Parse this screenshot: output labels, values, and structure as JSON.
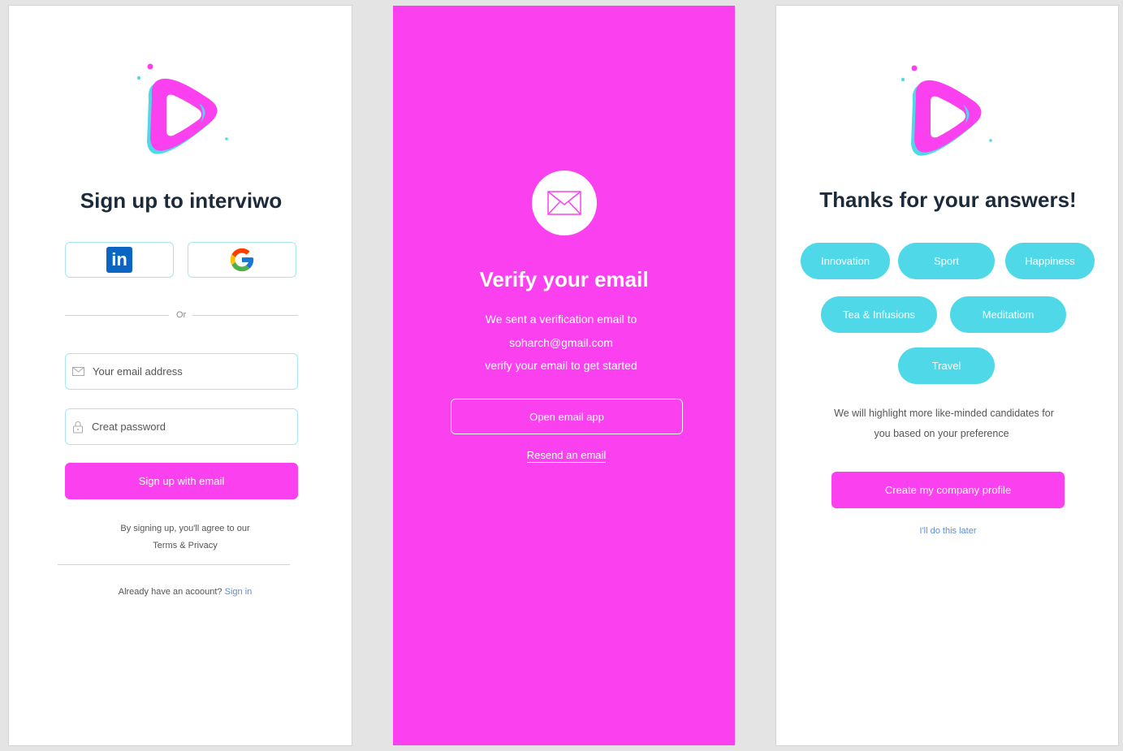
{
  "signup": {
    "title": "Sign up to interviwo",
    "or_text": "Or",
    "email_placeholder": "Your email address",
    "password_placeholder": "Creat password",
    "submit_label": "Sign up with email",
    "terms_line1": "By signing up, you'll agree to our",
    "terms_line2": "Terms & Privacy",
    "already_text": "Already have  an acoount?",
    "signin_link": "Sign in",
    "social_icons": [
      "linkedin-icon",
      "google-icon"
    ]
  },
  "verify": {
    "title": "Verify your email",
    "line1": "We sent a verification email to",
    "email": "soharch@gmail.com",
    "line3": "verify your email to get started",
    "open_button": "Open email app",
    "resend_link": "Resend an email"
  },
  "thanks": {
    "title": "Thanks for your answers!",
    "chips": [
      "Innovation",
      "Sport",
      "Happiness",
      "Tea & Infusions",
      "Meditatiom",
      "Travel"
    ],
    "pref_line1": "We will highlight more like-minded candidates for",
    "pref_line2": "you based on your preference",
    "create_button": "Create my company profile",
    "later_link": "I'll do this later"
  },
  "colors": {
    "brand_pink": "#fb41ef",
    "brand_cyan": "#4fd8e8",
    "title_dark": "#1d2a3a",
    "link_blue": "#5a8fd8"
  }
}
